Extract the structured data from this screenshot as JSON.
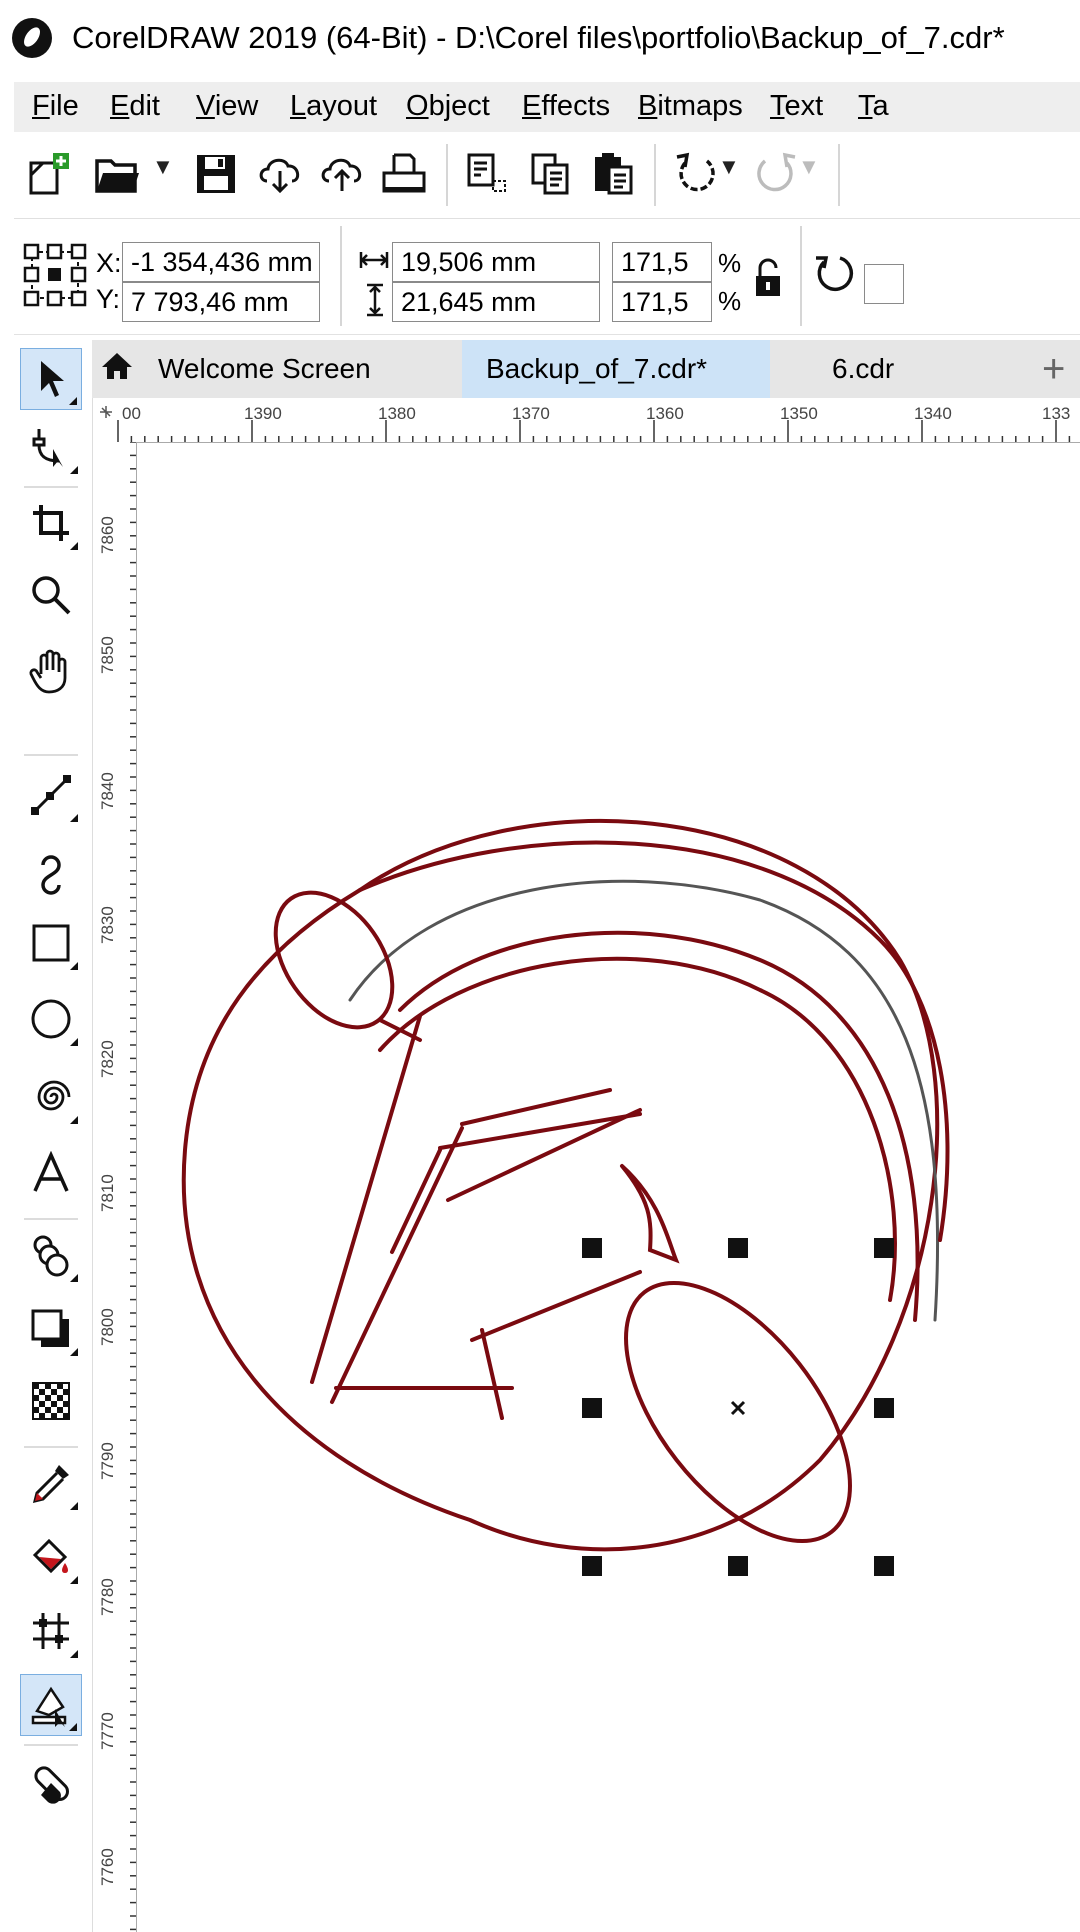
{
  "window": {
    "title": "CorelDRAW 2019 (64-Bit) - D:\\Corel files\\portfolio\\Backup_of_7.cdr*"
  },
  "menu": [
    "File",
    "Edit",
    "View",
    "Layout",
    "Object",
    "Effects",
    "Bitmaps",
    "Text",
    "Ta"
  ],
  "toolbar": {
    "icons": [
      "new-document-icon",
      "open-folder-icon",
      "save-icon",
      "cloud-download-icon",
      "cloud-upload-icon",
      "print-icon",
      "cut-icon",
      "copy-icon",
      "paste-icon",
      "undo-icon",
      "redo-icon"
    ]
  },
  "property_bar": {
    "x_label": "X:",
    "x_value": "-1 354,436 mm",
    "y_label": "Y:",
    "y_value": "7 793,46 mm",
    "width_value": "19,506 mm",
    "height_value": "21,645 mm",
    "scale_x": "171,5",
    "scale_y": "171,5",
    "percent": "%"
  },
  "tabs": {
    "welcome": "Welcome Screen",
    "active": "Backup_of_7.cdr*",
    "other": "6.cdr",
    "add": "+"
  },
  "ruler": {
    "corner": "00",
    "horizontal": [
      "1390",
      "1380",
      "1370",
      "1360",
      "1350",
      "1340",
      "133"
    ],
    "vertical": [
      "7860",
      "7850",
      "7840",
      "7830",
      "7820",
      "7810",
      "7800",
      "7790",
      "7780",
      "7770",
      "7760"
    ]
  },
  "toolbox": [
    "pick-tool-icon",
    "shape-tool-icon",
    "crop-tool-icon",
    "zoom-tool-icon",
    "pan-tool-icon",
    "line-tool-icon",
    "artistic-media-icon",
    "rectangle-tool-icon",
    "ellipse-tool-icon",
    "spiral-tool-icon",
    "text-tool-icon",
    "blend-tool-icon",
    "drop-shadow-icon",
    "transparency-icon",
    "eyedropper-icon",
    "interactive-fill-icon",
    "mesh-fill-icon",
    "smart-fill-icon",
    "eraser-icon"
  ],
  "colors": {
    "stroke": "#7a0a10",
    "tab_active": "#cde3f7",
    "menubar": "#eeeeee"
  }
}
